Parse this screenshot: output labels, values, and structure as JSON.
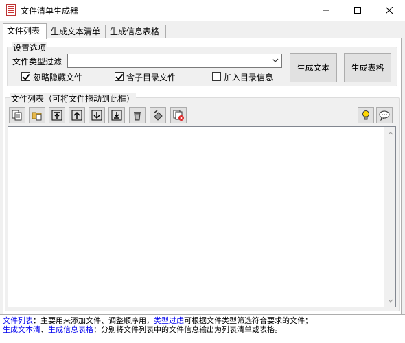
{
  "window": {
    "title": "文件清单生成器",
    "icon": "document-list-icon"
  },
  "tabs": [
    {
      "label": "文件列表",
      "active": true
    },
    {
      "label": "生成文本清单",
      "active": false
    },
    {
      "label": "生成信息表格",
      "active": false
    }
  ],
  "settings": {
    "legend": "设置选项",
    "filter_label": "文件类型过滤",
    "filter_value": "",
    "ignore_hidden_label": "忽略隐藏文件",
    "ignore_hidden_checked": true,
    "include_subdirs_label": "含子目录文件",
    "include_subdirs_checked": true,
    "add_dir_info_label": "加入目录信息",
    "add_dir_info_checked": false,
    "gen_text_button": "生成文本",
    "gen_table_button": "生成表格"
  },
  "file_list": {
    "legend": "文件列表（可将文件拖动到此框）",
    "items": [],
    "toolbar": [
      {
        "icon": "add-files-icon"
      },
      {
        "icon": "add-folder-icon"
      },
      {
        "icon": "move-top-icon"
      },
      {
        "icon": "move-up-icon"
      },
      {
        "icon": "move-down-icon"
      },
      {
        "icon": "move-bottom-icon"
      },
      {
        "icon": "delete-icon"
      },
      {
        "icon": "clear-list-icon"
      },
      {
        "icon": "remove-invalid-icon"
      },
      {
        "icon": "tip-lightbulb-icon"
      },
      {
        "icon": "chat-bubble-icon"
      }
    ]
  },
  "statusbar": {
    "line1_term1": "文件列表",
    "line1_text1": "：主要用来添加文件、调整顺序用，",
    "line1_term2": "类型过虑",
    "line1_text2": "可根据文件类型筛选符合要求的文件；",
    "line2_term1": "生成文本清",
    "line2_sep": "、",
    "line2_term2": "生成信息表格",
    "line2_text": "：分别将文件列表中的文件信息输出为列表清单或表格。"
  },
  "colors": {
    "link_blue": "#0000ee",
    "tab_border": "#adadad",
    "button_face": "#e1e1e1"
  }
}
